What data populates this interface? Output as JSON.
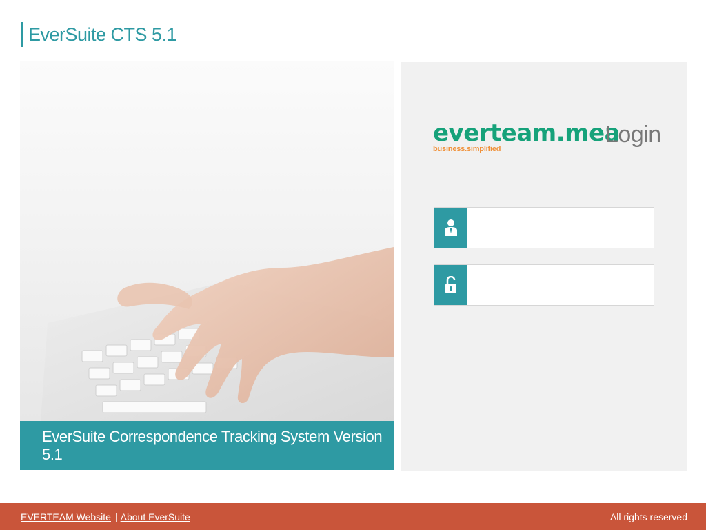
{
  "header": {
    "app_title": "EverSuite CTS 5.1"
  },
  "carousel": {
    "caption": "EverSuite Correspondence Tracking System Version 5.1",
    "prev_symbol": "‹",
    "next_symbol": "›"
  },
  "login": {
    "brand_name": "everteam.mea",
    "brand_tagline": "business.simplified",
    "heading": "Login",
    "username_value": "",
    "password_value": ""
  },
  "footer": {
    "links": [
      "EVERTEAM Website",
      "About EverSuite"
    ],
    "separator": "|",
    "rights": "All rights reserved"
  },
  "colors": {
    "teal": "#2e9aa3",
    "brand_green": "#16a27a",
    "brand_orange": "#f0913a",
    "footer_bg": "#c9553a",
    "panel_bg": "#f1f1f1"
  },
  "icons": {
    "username": "user-icon",
    "password": "lock-icon"
  }
}
